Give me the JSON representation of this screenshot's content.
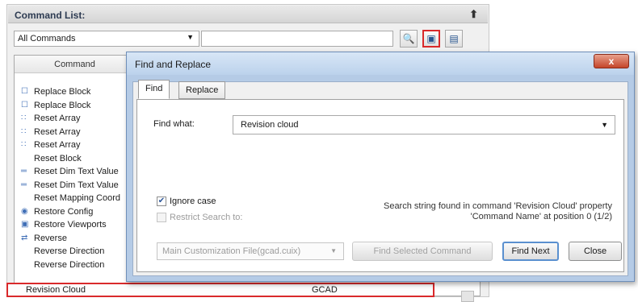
{
  "command_list": {
    "title": "Command List:",
    "filter_value": "All Commands",
    "column_header": "Command",
    "items": [
      {
        "label": "Replace Block",
        "icon": "block-icon"
      },
      {
        "label": "Replace Block",
        "icon": "block-icon"
      },
      {
        "label": "Reset Array",
        "icon": "array-icon"
      },
      {
        "label": "Reset Array",
        "icon": "array-icon"
      },
      {
        "label": "Reset Array",
        "icon": "array-icon"
      },
      {
        "label": "Reset Block",
        "icon": ""
      },
      {
        "label": "Reset Dim Text Value",
        "icon": "dim-icon"
      },
      {
        "label": "Reset Dim Text Value",
        "icon": "dim-icon"
      },
      {
        "label": "Reset Mapping Coord",
        "icon": ""
      },
      {
        "label": "Restore Config",
        "icon": "config-icon"
      },
      {
        "label": "Restore Viewports",
        "icon": "viewport-icon"
      },
      {
        "label": "Reverse",
        "icon": "reverse-icon"
      },
      {
        "label": "Reverse Direction",
        "icon": ""
      },
      {
        "label": "Reverse Direction",
        "icon": ""
      }
    ],
    "highlighted_row": {
      "label": "Revision Cloud",
      "group": "GCAD"
    }
  },
  "dialog": {
    "title": "Find and Replace",
    "close_label": "x",
    "tabs": [
      {
        "label": "Find",
        "active": true
      },
      {
        "label": "Replace",
        "active": false
      }
    ],
    "find_what_label": "Find what:",
    "find_what_value": "Revision cloud",
    "ignore_case_label": "Ignore case",
    "ignore_case_checked": true,
    "restrict_label": "Restrict Search to:",
    "restrict_checked": false,
    "status_line1": "Search string found in command 'Revision Cloud' property",
    "status_line2": "'Command Name' at position 0 (1/2)",
    "custom_file_value": "Main Customization File(gcad.cuix)",
    "find_selected_label": "Find Selected Command",
    "find_next_label": "Find Next",
    "close_button_label": "Close"
  },
  "colors": {
    "highlight_red": "#d9292b",
    "title_bar": "#bcd2ec",
    "accent_blue": "#5a90cf"
  }
}
